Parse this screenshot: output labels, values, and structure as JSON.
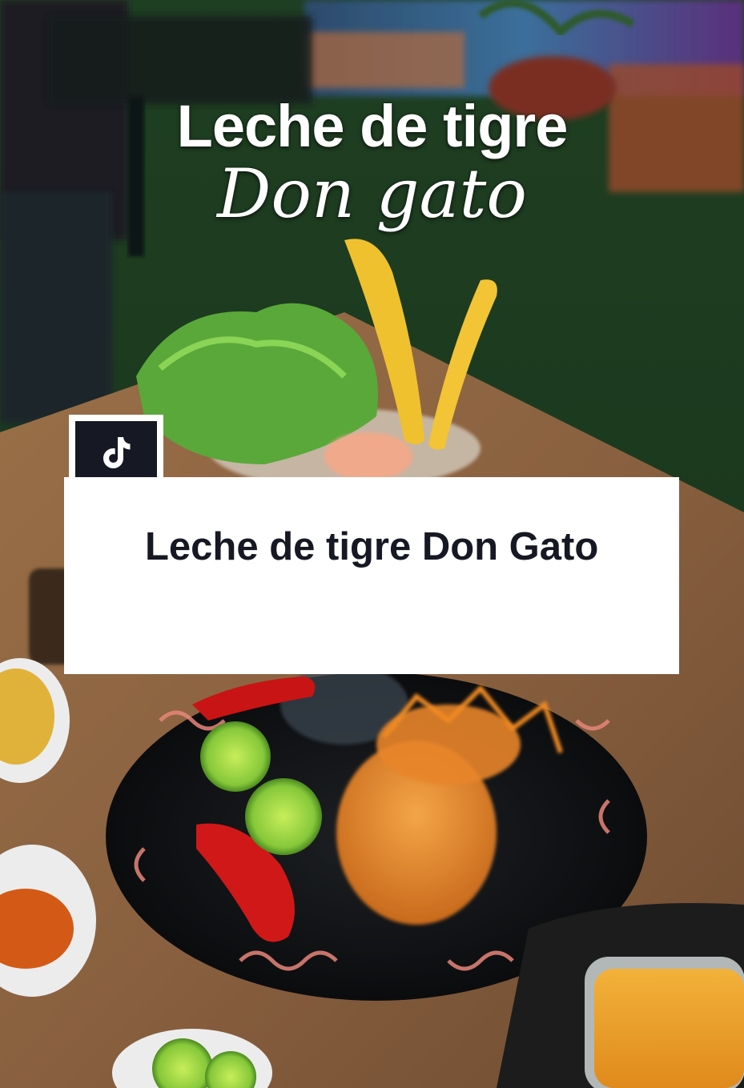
{
  "headline": {
    "line1": "Leche de tigre",
    "line2": "Don  gato"
  },
  "badge": {
    "icon": "tiktok-logo-icon"
  },
  "caption": {
    "text": "Leche de tigre Don Gato"
  },
  "colors": {
    "card_background": "#ffffff",
    "caption_text": "#161823",
    "badge_background": "#161823"
  }
}
